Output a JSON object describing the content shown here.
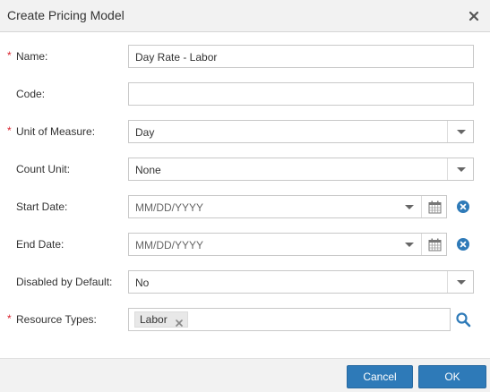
{
  "dialog": {
    "title": "Create Pricing Model",
    "close_icon": "close-icon"
  },
  "form": {
    "required_marker": "*",
    "name": {
      "label": "Name:",
      "value": "Day Rate - Labor",
      "required": true
    },
    "code": {
      "label": "Code:",
      "value": "",
      "required": false
    },
    "unit_of_measure": {
      "label": "Unit of Measure:",
      "value": "Day",
      "required": true
    },
    "count_unit": {
      "label": "Count Unit:",
      "value": "None",
      "required": false
    },
    "start_date": {
      "label": "Start Date:",
      "placeholder": "MM/DD/YYYY",
      "required": false
    },
    "end_date": {
      "label": "End Date:",
      "placeholder": "MM/DD/YYYY",
      "required": false
    },
    "disabled_by_default": {
      "label": "Disabled by Default:",
      "value": "No",
      "required": false
    },
    "resource_types": {
      "label": "Resource Types:",
      "tags": [
        "Labor"
      ],
      "required": true
    }
  },
  "footer": {
    "cancel_label": "Cancel",
    "ok_label": "OK"
  },
  "colors": {
    "primary_button": "#2e7ab8",
    "required": "#d9232e",
    "icon_blue": "#2e7ab8",
    "header_bg": "#f2f2f2"
  }
}
